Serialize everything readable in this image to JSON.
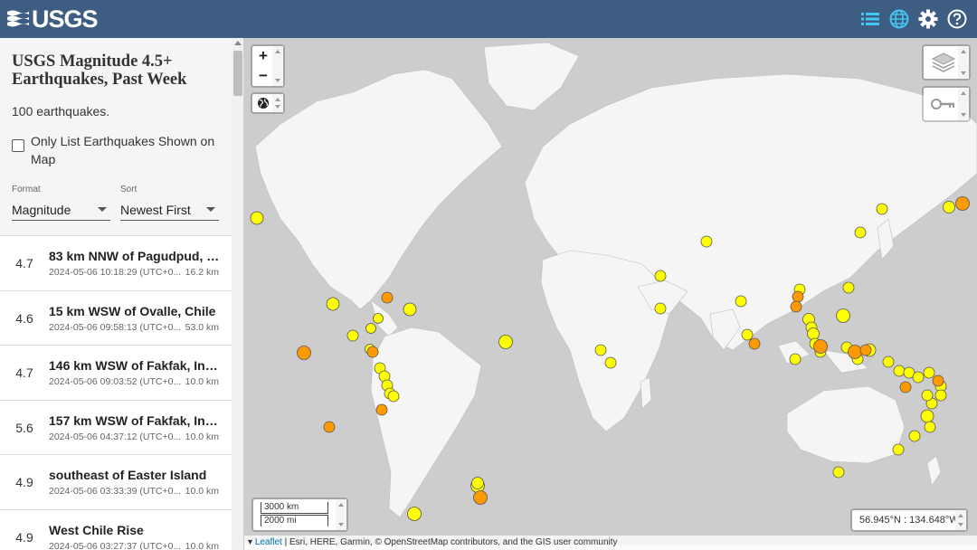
{
  "app": {
    "logo_text": "USGS"
  },
  "header": {
    "icons": [
      "list-icon",
      "globe-icon",
      "gear-icon",
      "help-icon"
    ],
    "accent_color": "#45c6f0",
    "bar_color": "#3e5d82"
  },
  "sidebar": {
    "title": "USGS Magnitude 4.5+ Earthquakes, Past Week",
    "count": "100 earthquakes.",
    "only_list_label": "Only List Earthquakes Shown on Map",
    "format": {
      "label": "Format",
      "value": "Magnitude"
    },
    "sort": {
      "label": "Sort",
      "value": "Newest First"
    },
    "earthquakes": [
      {
        "mag": "4.7",
        "place": "83 km NNW of Pagudpud, Ph...",
        "time": "2024-05-06 10:18:29 (UTC+0...",
        "depth": "16.2 km"
      },
      {
        "mag": "4.6",
        "place": "15 km WSW of Ovalle, Chile",
        "time": "2024-05-06 09:58:13 (UTC+0...",
        "depth": "53.0 km"
      },
      {
        "mag": "4.7",
        "place": "146 km WSW of Fakfak, Indo...",
        "time": "2024-05-06 09:03:52 (UTC+0...",
        "depth": "10.0 km"
      },
      {
        "mag": "5.6",
        "place": "157 km WSW of Fakfak, Indo...",
        "time": "2024-05-06 04:37:12 (UTC+0...",
        "depth": "10.0 km"
      },
      {
        "mag": "4.9",
        "place": "southeast of Easter Island",
        "time": "2024-05-06 03:33:39 (UTC+0...",
        "depth": "10.0 km"
      },
      {
        "mag": "4.9",
        "place": "West Chile Rise",
        "time": "2024-05-06 03:27:37 (UTC+0...",
        "depth": "10.0 km"
      }
    ]
  },
  "map": {
    "zoom_in": "+",
    "zoom_out": "−",
    "scale_km": "3000 km",
    "scale_mi": "2000 mi",
    "coords": "56.945°N : 134.648°W",
    "attribution_link": "Leaflet",
    "attribution_text": " | Esri, HERE, Garmin, © OpenStreetMap contributors, and the GIS user community",
    "marker_colors": {
      "recent": "#ff9900",
      "older": "#ffff00"
    },
    "land_color": "#f5f5f5",
    "water_color": "#cdcdcd"
  }
}
